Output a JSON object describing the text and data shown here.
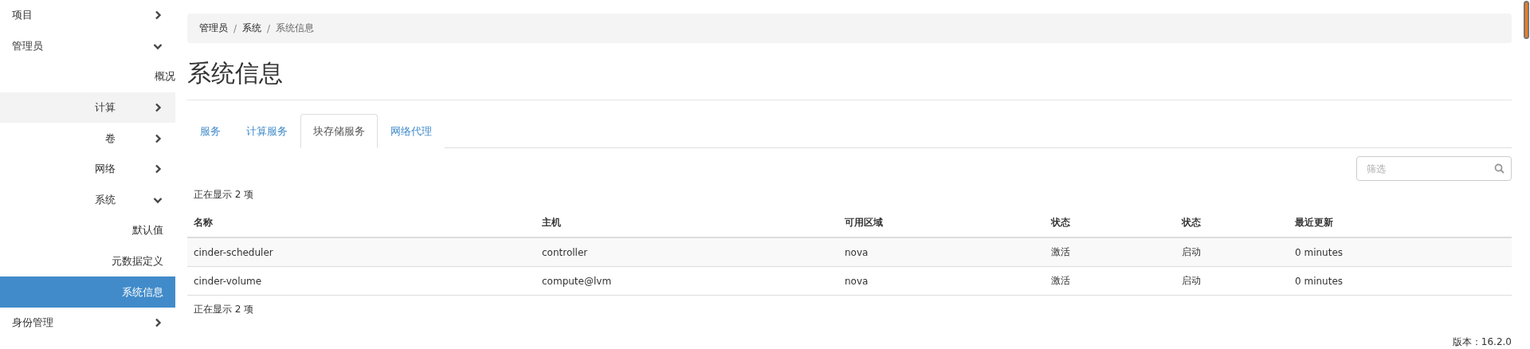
{
  "sidebar": {
    "items": [
      {
        "label": "项目",
        "kind": "group",
        "expanded": false,
        "selected": false,
        "highlighted": false
      },
      {
        "label": "管理员",
        "kind": "group",
        "expanded": true,
        "selected": false,
        "highlighted": false,
        "children": [
          {
            "label": "概况",
            "kind": "link",
            "selected": false,
            "highlighted": false
          },
          {
            "label": "计算",
            "kind": "group",
            "expanded": false,
            "selected": false,
            "highlighted": true
          },
          {
            "label": "卷",
            "kind": "group",
            "expanded": false,
            "selected": false,
            "highlighted": false
          },
          {
            "label": "网络",
            "kind": "group",
            "expanded": false,
            "selected": false,
            "highlighted": false
          },
          {
            "label": "系统",
            "kind": "group",
            "expanded": true,
            "selected": false,
            "highlighted": false,
            "children": [
              {
                "label": "默认值",
                "kind": "link",
                "selected": false,
                "highlighted": false
              },
              {
                "label": "元数据定义",
                "kind": "link",
                "selected": false,
                "highlighted": false
              },
              {
                "label": "系统信息",
                "kind": "link",
                "selected": true,
                "highlighted": false
              }
            ]
          }
        ]
      },
      {
        "label": "身份管理",
        "kind": "group",
        "expanded": false,
        "selected": false,
        "highlighted": false
      }
    ]
  },
  "breadcrumb": [
    "管理员",
    "系统",
    "系统信息"
  ],
  "breadcrumb_separator": "/",
  "page_title": "系统信息",
  "tabs": [
    {
      "label": "服务",
      "selected": false
    },
    {
      "label": "计算服务",
      "selected": false
    },
    {
      "label": "块存储服务",
      "selected": true
    },
    {
      "label": "网络代理",
      "selected": false
    }
  ],
  "filter": {
    "placeholder": "筛选"
  },
  "count_top": "正在显示 2 项",
  "table": {
    "columns": [
      "名称",
      "主机",
      "可用区域",
      "状态",
      "状态",
      "最近更新"
    ],
    "rows": [
      [
        "cinder-scheduler",
        "controller",
        "nova",
        "激活",
        "启动",
        "0 minutes"
      ],
      [
        "cinder-volume",
        "compute@lvm",
        "nova",
        "激活",
        "启动",
        "0 minutes"
      ]
    ]
  },
  "count_bottom": "正在显示 2 项",
  "version": "版本：16.2.0"
}
